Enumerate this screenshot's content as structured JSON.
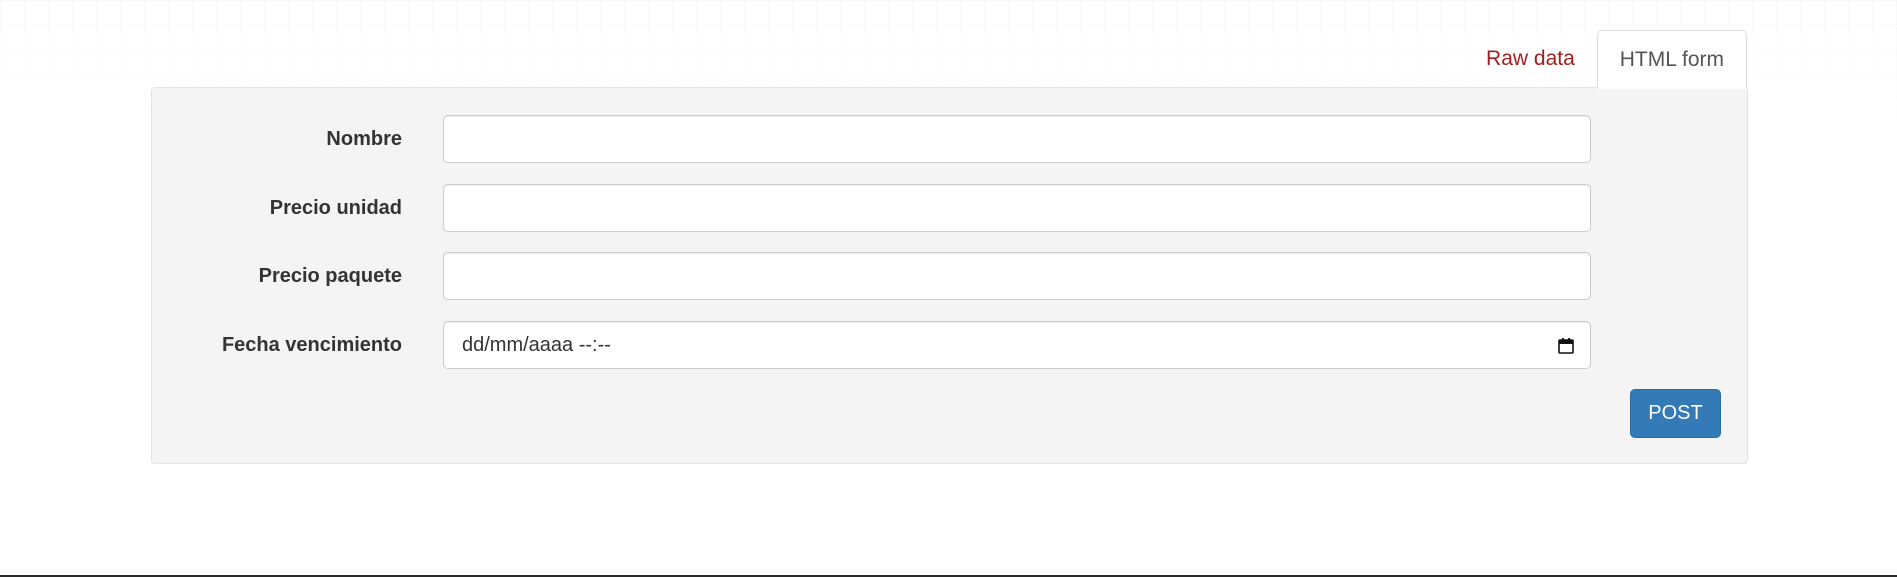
{
  "tabs": [
    {
      "label": "Raw data",
      "active": false
    },
    {
      "label": "HTML form",
      "active": true
    }
  ],
  "form": {
    "fields": [
      {
        "label": "Nombre",
        "value": "",
        "type": "text"
      },
      {
        "label": "Precio unidad",
        "value": "",
        "type": "text"
      },
      {
        "label": "Precio paquete",
        "value": "",
        "type": "text"
      },
      {
        "label": "Fecha vencimiento",
        "value": "",
        "type": "datetime-local",
        "placeholder": "dd/mm/aaaa --:--"
      }
    ],
    "submit_label": "POST"
  },
  "icons": {
    "date_picker": "calendar-icon"
  },
  "colors": {
    "tab_link": "#a11f1f",
    "panel_bg": "#f4f4f4",
    "primary_button": "#337ab7"
  }
}
